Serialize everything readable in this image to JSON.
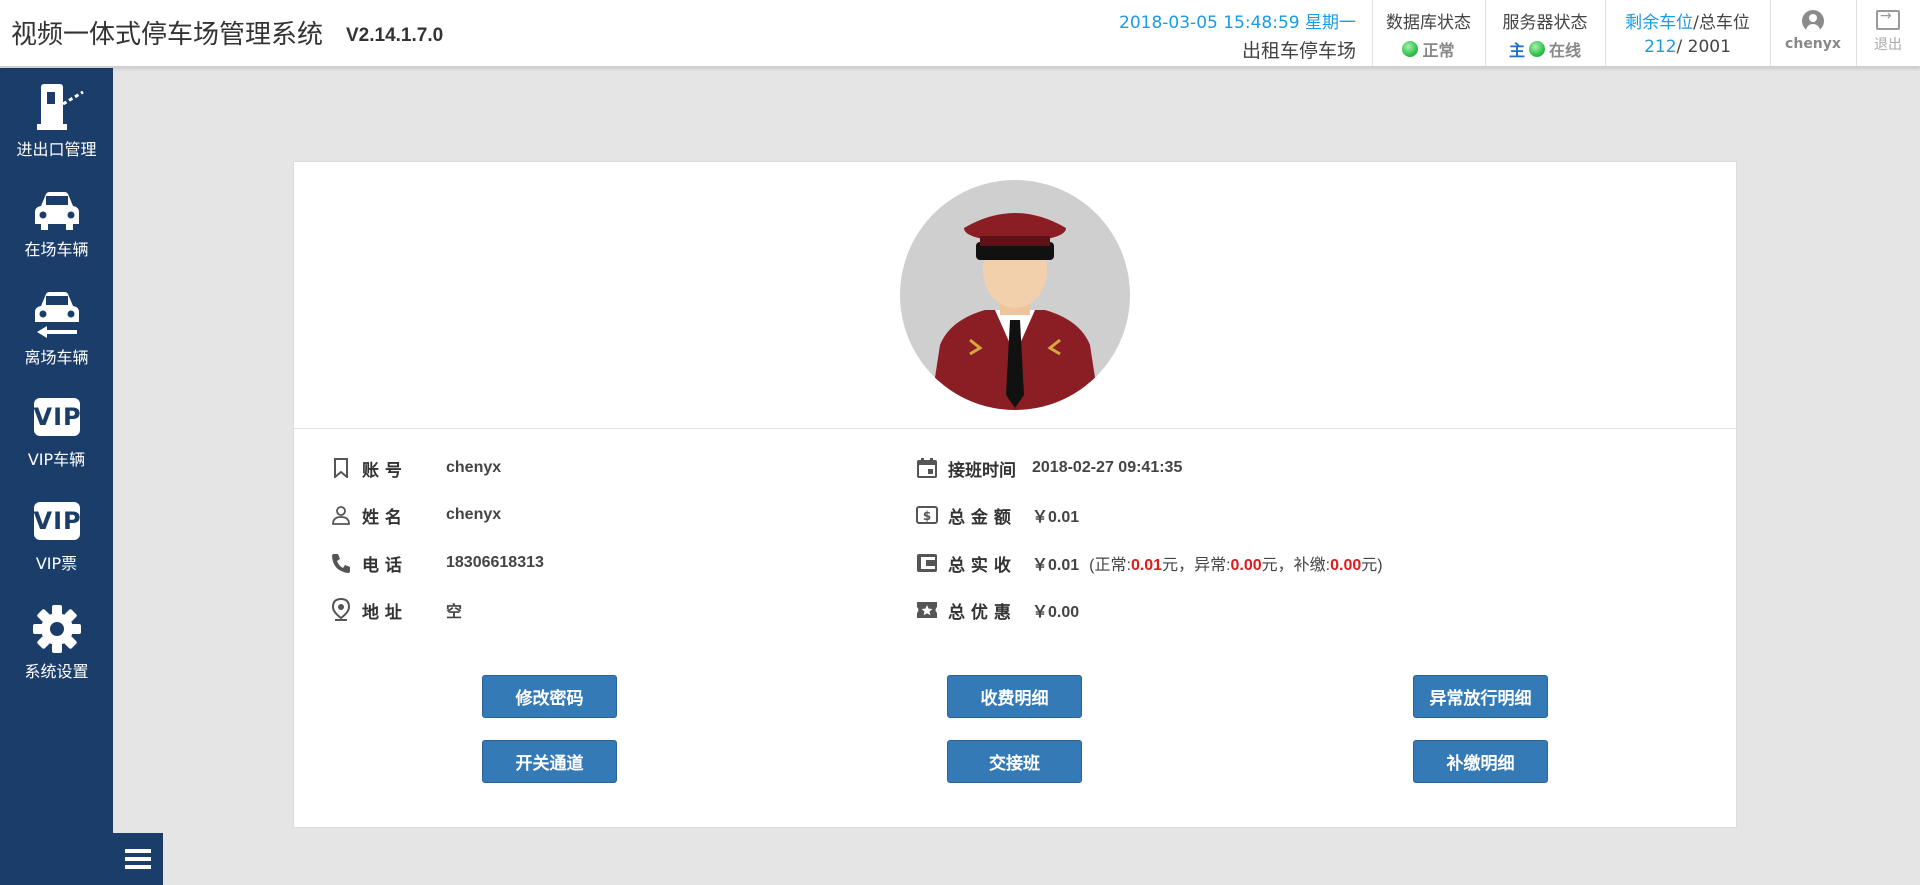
{
  "header": {
    "app_title": "视频一体式停车场管理系统",
    "version": "V2.14.1.7.0",
    "datetime": "2018-03-05 15:48:59 星期一",
    "lot_name": "出租车停车场",
    "db_status": {
      "title": "数据库状态",
      "value": "正常",
      "indicator_color": "#2ec24a"
    },
    "server_status": {
      "title": "服务器状态",
      "main_label": "主",
      "value": "在线",
      "indicator_color": "#2ec24a"
    },
    "spaces": {
      "remaining_label": "剩余车位",
      "total_label": "/总车位",
      "remaining": "212",
      "total": "/ 2001"
    },
    "user": {
      "name": "chenyx",
      "icon": "user-circle-icon"
    },
    "logout": {
      "label": "退出",
      "icon": "logout-icon"
    }
  },
  "sidebar": {
    "items": [
      {
        "label": "进出口管理",
        "icon": "barrier-gate-icon"
      },
      {
        "label": "在场车辆",
        "icon": "car-front-icon"
      },
      {
        "label": "离场车辆",
        "icon": "car-exit-icon"
      },
      {
        "label": "VIP车辆",
        "icon": "vip-icon",
        "badge": "VIP"
      },
      {
        "label": "VIP票",
        "icon": "vip-ticket-icon",
        "badge": "VIP"
      },
      {
        "label": "系统设置",
        "icon": "gear-icon"
      }
    ],
    "menu_icon": "hamburger-menu-icon"
  },
  "profile": {
    "avatar": "parking-attendant-avatar",
    "account": {
      "label": "账 号",
      "value": "chenyx",
      "icon": "bookmark-icon"
    },
    "name": {
      "label": "姓 名",
      "value": "chenyx",
      "icon": "person-icon"
    },
    "phone": {
      "label": "电 话",
      "value": "18306618313",
      "icon": "phone-icon"
    },
    "address": {
      "label": "地 址",
      "value": "空",
      "icon": "location-pin-icon"
    },
    "shift_time": {
      "label": "接班时间",
      "value": "2018-02-27 09:41:35",
      "icon": "calendar-icon"
    },
    "total_amount": {
      "label": "总 金 额",
      "value": "￥0.01",
      "icon": "money-icon"
    },
    "total_received": {
      "label": "总 实 收",
      "value": "￥0.01",
      "icon": "wallet-icon",
      "breakdown": {
        "open": "(正常:",
        "normal": "0.01",
        "t1": "元，异常:",
        "abnormal": "0.00",
        "t2": "元，补缴:",
        "makeup": "0.00",
        "t3": "元)"
      }
    },
    "total_discount": {
      "label": "总 优 惠",
      "value": "￥0.00",
      "icon": "ticket-star-icon"
    }
  },
  "buttons": {
    "change_password": "修改密码",
    "fee_details": "收费明细",
    "abnormal_release_details": "异常放行明细",
    "toggle_channel": "开关通道",
    "shift_handover": "交接班",
    "makeup_payment_details": "补缴明细"
  },
  "colors": {
    "primary": "#337ab7",
    "sidebar": "#1b3d6a",
    "accent_blue": "#1a9be6",
    "money_red": "#e01b1b"
  }
}
